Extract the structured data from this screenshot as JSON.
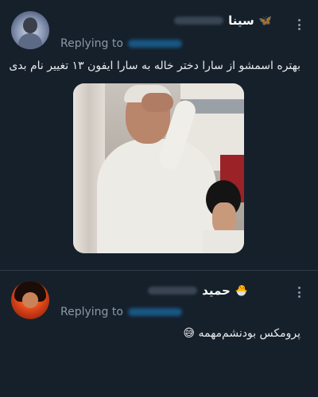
{
  "tweets": [
    {
      "display_name": "سینا",
      "badge_icon": "butterfly-icon",
      "badge_glyph": "🦋",
      "replying_label": "Replying to",
      "text": "بهتره اسمشو از سارا دختر خاله به سارا ایفون ۱۳ تغییر نام بدی",
      "has_media": true
    },
    {
      "display_name": "حمید",
      "badge_icon": "chick-icon",
      "badge_glyph": "🐣",
      "replying_label": "Replying to",
      "text": "پرومکس بودنشم‌مهمه 😅",
      "has_media": false
    }
  ],
  "colors": {
    "background": "#15202b",
    "text": "#e7e9ea",
    "secondary": "#8b98a5",
    "accent": "#1d9bf0",
    "divider": "#2f3b47"
  }
}
